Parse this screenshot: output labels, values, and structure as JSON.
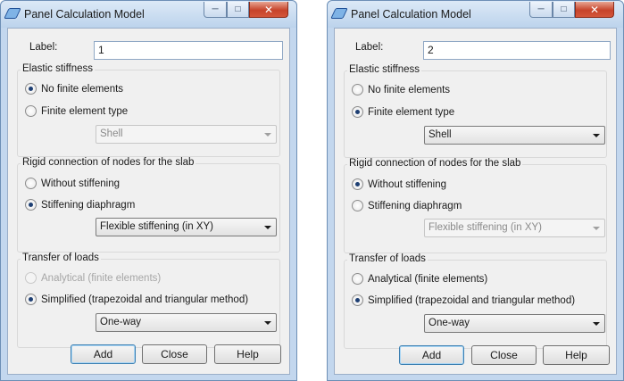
{
  "windows": [
    {
      "title": "Panel Calculation Model",
      "label_caption": "Label:",
      "label_value": "1",
      "elastic": {
        "title": "Elastic stiffness",
        "option_no_fe": "No finite elements",
        "option_fe_type": "Finite element type",
        "selected": "No finite elements",
        "fe_type_value": "Shell",
        "fe_type_enabled": false
      },
      "rigid": {
        "title": "Rigid connection of nodes for the slab",
        "option_without": "Without stiffening",
        "option_diaphragm": "Stiffening diaphragm",
        "selected": "Stiffening diaphragm",
        "diaphragm_value": "Flexible stiffening (in XY)",
        "diaphragm_enabled": true
      },
      "transfer": {
        "title": "Transfer of loads",
        "option_analytical": "Analytical (finite elements)",
        "option_simplified": "Simplified (trapezoidal and triangular method)",
        "selected": "Simplified (trapezoidal and triangular method)",
        "analytical_enabled": false,
        "method_value": "One-way"
      },
      "buttons": {
        "add": "Add",
        "close": "Close",
        "help": "Help"
      }
    },
    {
      "title": "Panel Calculation Model",
      "label_caption": "Label:",
      "label_value": "2",
      "elastic": {
        "title": "Elastic stiffness",
        "option_no_fe": "No finite elements",
        "option_fe_type": "Finite element type",
        "selected": "Finite element type",
        "fe_type_value": "Shell",
        "fe_type_enabled": true
      },
      "rigid": {
        "title": "Rigid connection of nodes for the slab",
        "option_without": "Without stiffening",
        "option_diaphragm": "Stiffening diaphragm",
        "selected": "Without stiffening",
        "diaphragm_value": "Flexible stiffening (in XY)",
        "diaphragm_enabled": false
      },
      "transfer": {
        "title": "Transfer of loads",
        "option_analytical": "Analytical (finite elements)",
        "option_simplified": "Simplified (trapezoidal and triangular method)",
        "selected": "Simplified (trapezoidal and triangular method)",
        "analytical_enabled": true,
        "method_value": "One-way"
      },
      "buttons": {
        "add": "Add",
        "close": "Close",
        "help": "Help"
      }
    }
  ],
  "icons": {
    "app": "pencil-icon",
    "minimize": "minimize-icon",
    "maximize": "maximize-icon",
    "close": "close-icon",
    "dropdown": "chevron-down-icon"
  },
  "colors": {
    "window_frame": "#c3d7ee",
    "dialog_bg": "#f0f0f0",
    "close_button": "#c7442b",
    "default_button_border": "#3c7fb1"
  }
}
